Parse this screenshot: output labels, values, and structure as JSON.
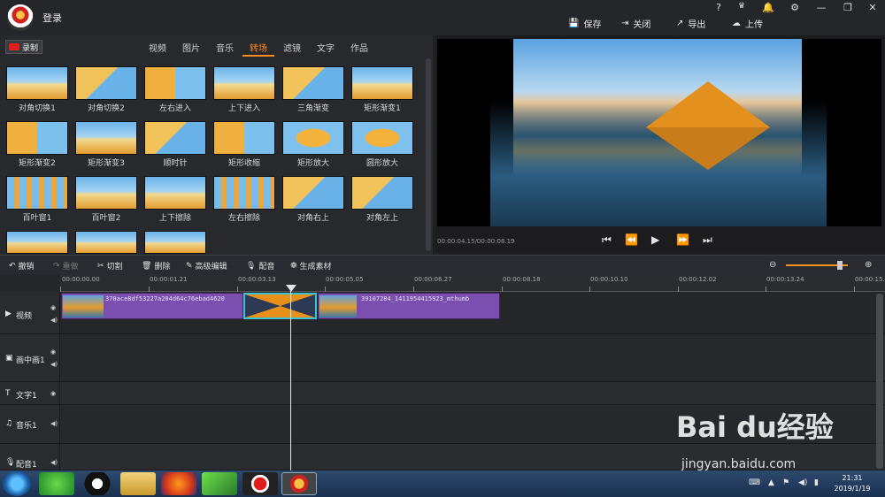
{
  "header": {
    "login_label": "登录",
    "help": "?",
    "vip": "VIP",
    "actions": [
      {
        "label": "保存",
        "icon": "save-icon"
      },
      {
        "label": "关闭",
        "icon": "close-icon"
      },
      {
        "label": "导出",
        "icon": "export-icon"
      },
      {
        "label": "上传",
        "icon": "upload-icon"
      }
    ]
  },
  "library": {
    "record_label": "录制",
    "tabs": [
      "视频",
      "图片",
      "音乐",
      "转场",
      "滤镜",
      "文字",
      "作品"
    ],
    "active_tab": "转场",
    "items": [
      "对角切换1",
      "对角切换2",
      "左右进入",
      "上下进入",
      "三角渐变",
      "矩形渐变1",
      "矩形渐变2",
      "矩形渐变3",
      "顺时针",
      "矩形收缩",
      "矩形放大",
      "圆形放大",
      "百叶窗1",
      "百叶窗2",
      "上下擦除",
      "左右擦除",
      "对角右上",
      "对角左上"
    ]
  },
  "preview": {
    "timecode": "00:00:04.15/00:00:08.19"
  },
  "toolbar": {
    "undo": "撤销",
    "redo": "重做",
    "cut": "切割",
    "delete": "删除",
    "advanced_edit": "高级编辑",
    "dub": "配音",
    "generate": "生成素材"
  },
  "timeline": {
    "ruler": [
      "00:00:00.00",
      "00:00:01.21",
      "00:00:03.13",
      "00:00:05.05",
      "00:00:06.27",
      "00:00:08.18",
      "00:00:10.10",
      "00:00:12.02",
      "00:00:13.24",
      "00:00:15."
    ],
    "tracks": [
      "视频",
      "画中画1",
      "文字1",
      "音乐1",
      "配音1"
    ],
    "clip1": "370ace8df53227a204d64c76ebad4620",
    "clip2": "39107284_1411954415923_mthumb"
  },
  "taskbar": {
    "time": "21:31",
    "date": "2019/1/19"
  },
  "watermark": {
    "brand": "Bai du经验",
    "url": "jingyan.baidu.com"
  }
}
